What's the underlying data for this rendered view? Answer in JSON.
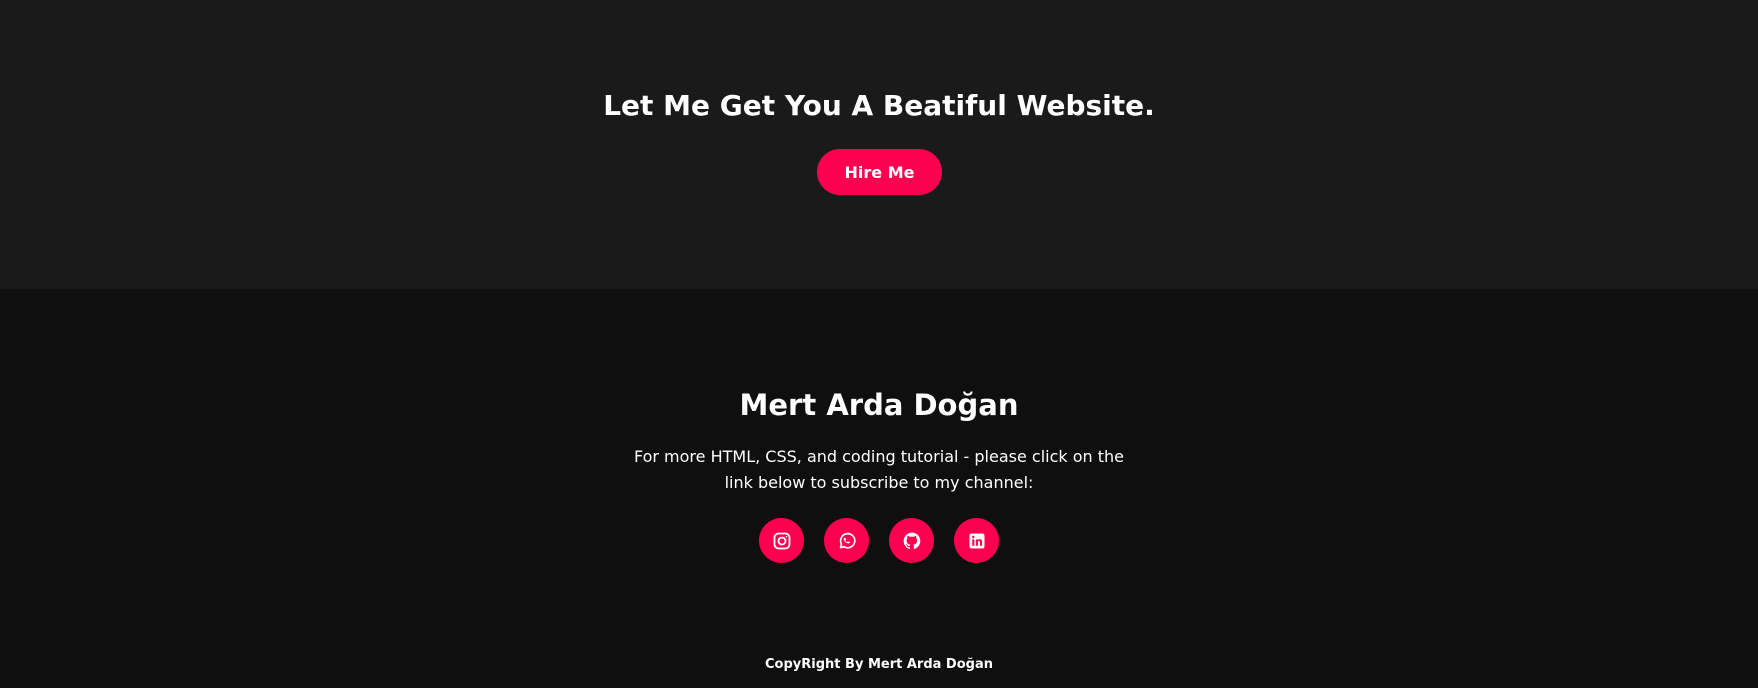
{
  "hire": {
    "title": "Let Me Get You A Beatiful Website.",
    "button_label": "Hire Me"
  },
  "footer": {
    "name": "Mert Arda Doğan",
    "text": "For more HTML, CSS, and coding tutorial - please click on the link below to subscribe to my channel:",
    "social": [
      {
        "icon": "instagram-icon"
      },
      {
        "icon": "whatsapp-icon"
      },
      {
        "icon": "github-icon"
      },
      {
        "icon": "linkedin-icon"
      }
    ],
    "copyright": "CopyRight By Mert Arda Doğan"
  },
  "colors": {
    "accent": "#ff0050",
    "hire_bg": "#1a1a1a",
    "footer_bg": "#0f0f0f",
    "text": "#ffffff"
  }
}
